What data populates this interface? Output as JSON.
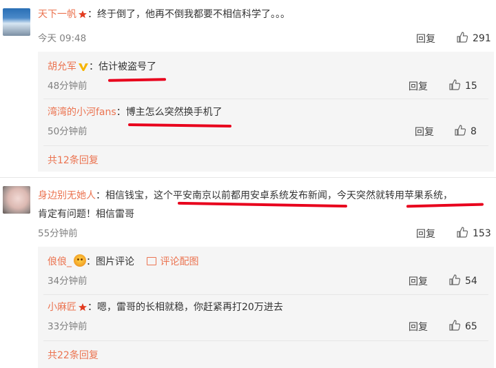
{
  "comments": [
    {
      "username": "天下一帆",
      "text": "终于倒了，他再不倒我都要不相信科学了。。。",
      "time": "今天 09:48",
      "reply_label": "回复",
      "likes": "291",
      "replies": [
        {
          "username": "胡允军",
          "text": "估计被盗号了",
          "time": "48分钟前",
          "reply_label": "回复",
          "likes": "15"
        },
        {
          "username": "湾湾的小河fans",
          "text": "博主怎么突然换手机了",
          "time": "50分钟前",
          "reply_label": "回复",
          "likes": "8"
        }
      ],
      "more_replies": "共12条回复"
    },
    {
      "username": "身边别无她人",
      "text_line1": "相信钱宝，这个平安南京以前都用安卓系统发布新闻，今天突然就转用苹果系统，",
      "text_line2": "肯定有问题！相信雷哥",
      "time": "55分钟前",
      "reply_label": "回复",
      "likes": "153",
      "replies": [
        {
          "username": "俍俍_",
          "text": "图片评论",
          "link": "评论配图",
          "time": "34分钟前",
          "reply_label": "回复",
          "likes": "54"
        },
        {
          "username": "小麻匠",
          "text": "嗯，雷哥的长相就稳，你赶紧再打20万进去",
          "time": "33分钟前",
          "reply_label": "回复",
          "likes": "65"
        }
      ],
      "more_replies": "共22条回复"
    }
  ],
  "separator": "：",
  "colors": {
    "username": "#eb7350",
    "annotation": "#e8001c",
    "sub_bg": "#f5f5f5",
    "vip": "#f7b500",
    "star": "#e23b1f"
  }
}
